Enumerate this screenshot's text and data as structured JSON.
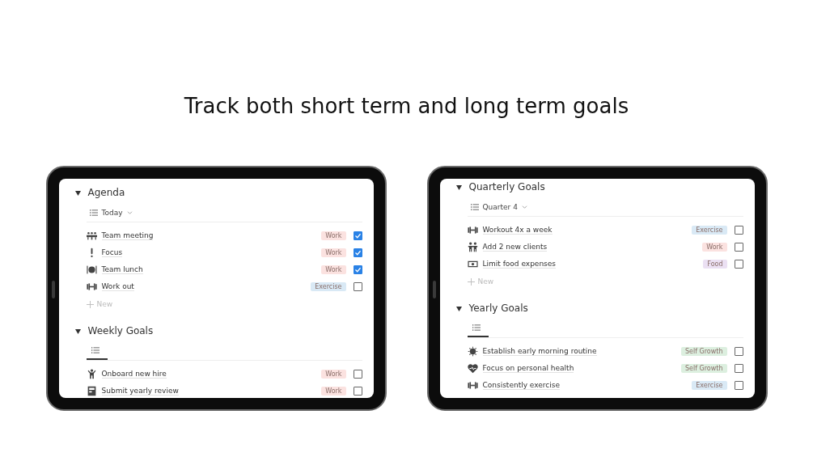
{
  "headline": "Track both short term and long term goals",
  "tablets": [
    {
      "sections": [
        {
          "title": "Agenda",
          "expanded": true,
          "view": {
            "label": "Today",
            "dropdown": true
          },
          "rows": [
            {
              "kind": "meeting",
              "title": "Team meeting",
              "tag": {
                "label": "Work",
                "color": "#fbe2e0"
              },
              "checked": true
            },
            {
              "kind": "exclamation",
              "title": "Focus",
              "tag": {
                "label": "Work",
                "color": "#fbe2e0"
              },
              "checked": true
            },
            {
              "kind": "plate",
              "title": "Team lunch",
              "tag": {
                "label": "Work",
                "color": "#fbe2e0"
              },
              "checked": true
            },
            {
              "kind": "dumbbell",
              "title": "Work out",
              "tag": {
                "label": "Exercise",
                "color": "#d9e9f5"
              },
              "checked": false
            }
          ],
          "new_label": "New"
        },
        {
          "title": "Weekly Goals",
          "expanded": true,
          "view": {
            "dropdown": false
          },
          "rows": [
            {
              "kind": "person",
              "title": "Onboard new hire",
              "tag": {
                "label": "Work",
                "color": "#fbe2e0"
              },
              "checked": false
            },
            {
              "kind": "form",
              "title": "Submit yearly review",
              "tag": {
                "label": "Work",
                "color": "#fbe2e0"
              },
              "checked": false
            }
          ]
        }
      ]
    },
    {
      "sections": [
        {
          "title": "Quarterly Goals",
          "expanded": true,
          "view": {
            "label": "Quarter 4",
            "dropdown": true
          },
          "rows": [
            {
              "kind": "dumbbell",
              "title": "Workout 4x a week",
              "tag": {
                "label": "Exercise",
                "color": "#d9e9f5"
              },
              "checked": false
            },
            {
              "kind": "people",
              "title": "Add 2 new clients",
              "tag": {
                "label": "Work",
                "color": "#fbe2e0"
              },
              "checked": false
            },
            {
              "kind": "money",
              "title": "Limit food expenses",
              "tag": {
                "label": "Food",
                "color": "#ebe0f3"
              },
              "checked": false
            }
          ],
          "new_label": "New"
        },
        {
          "title": "Yearly Goals",
          "expanded": true,
          "view": {
            "dropdown": false
          },
          "rows": [
            {
              "kind": "sun",
              "title": "Establish early morning routine",
              "tag": {
                "label": "Self Growth",
                "color": "#dcefdf"
              },
              "checked": false
            },
            {
              "kind": "heart",
              "title": "Focus on personal health",
              "tag": {
                "label": "Self Growth",
                "color": "#dcefdf"
              },
              "checked": false
            },
            {
              "kind": "dumbbell",
              "title": "Consistently exercise",
              "tag": {
                "label": "Exercise",
                "color": "#d9e9f5"
              },
              "checked": false
            }
          ]
        }
      ]
    }
  ]
}
